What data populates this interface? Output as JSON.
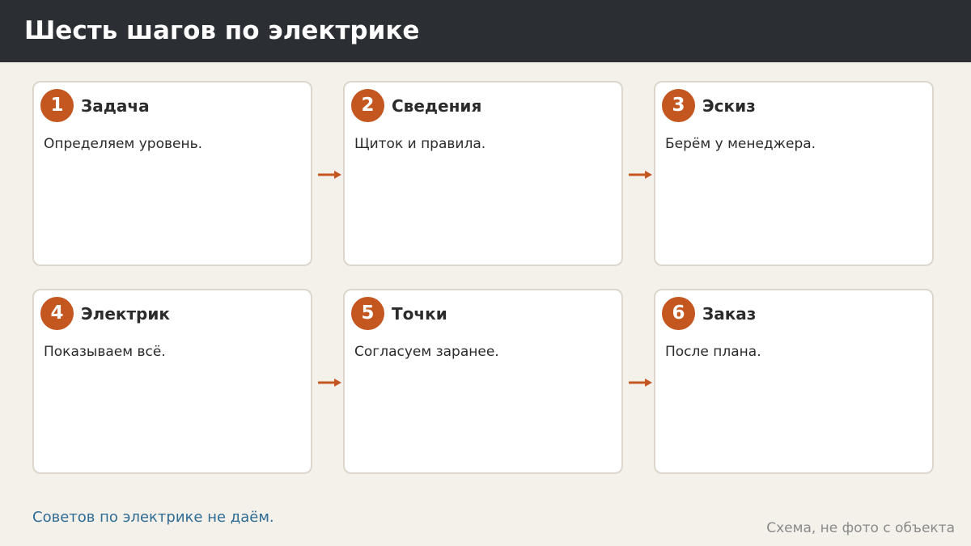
{
  "header": {
    "title": "Шесть шагов по электрике"
  },
  "steps": [
    {
      "number": "1",
      "title": "Задача",
      "description": "Определяем уровень."
    },
    {
      "number": "2",
      "title": "Сведения",
      "description": "Щиток и правила."
    },
    {
      "number": "3",
      "title": "Эскиз",
      "description": "Берём у менеджера."
    },
    {
      "number": "4",
      "title": "Электрик",
      "description": "Показываем всё."
    },
    {
      "number": "5",
      "title": "Точки",
      "description": "Согласуем заранее."
    },
    {
      "number": "6",
      "title": "Заказ",
      "description": "После плана."
    }
  ],
  "footer": {
    "note": "Советов по электрике не даём.",
    "caption": "Схема, не фото с объекта"
  },
  "colors": {
    "accent": "#c4561f",
    "header_bg": "#2b2e33",
    "page_bg": "#f4f1eb",
    "link": "#2f6c94"
  },
  "icons": {
    "connector": "arrow-right-icon"
  }
}
